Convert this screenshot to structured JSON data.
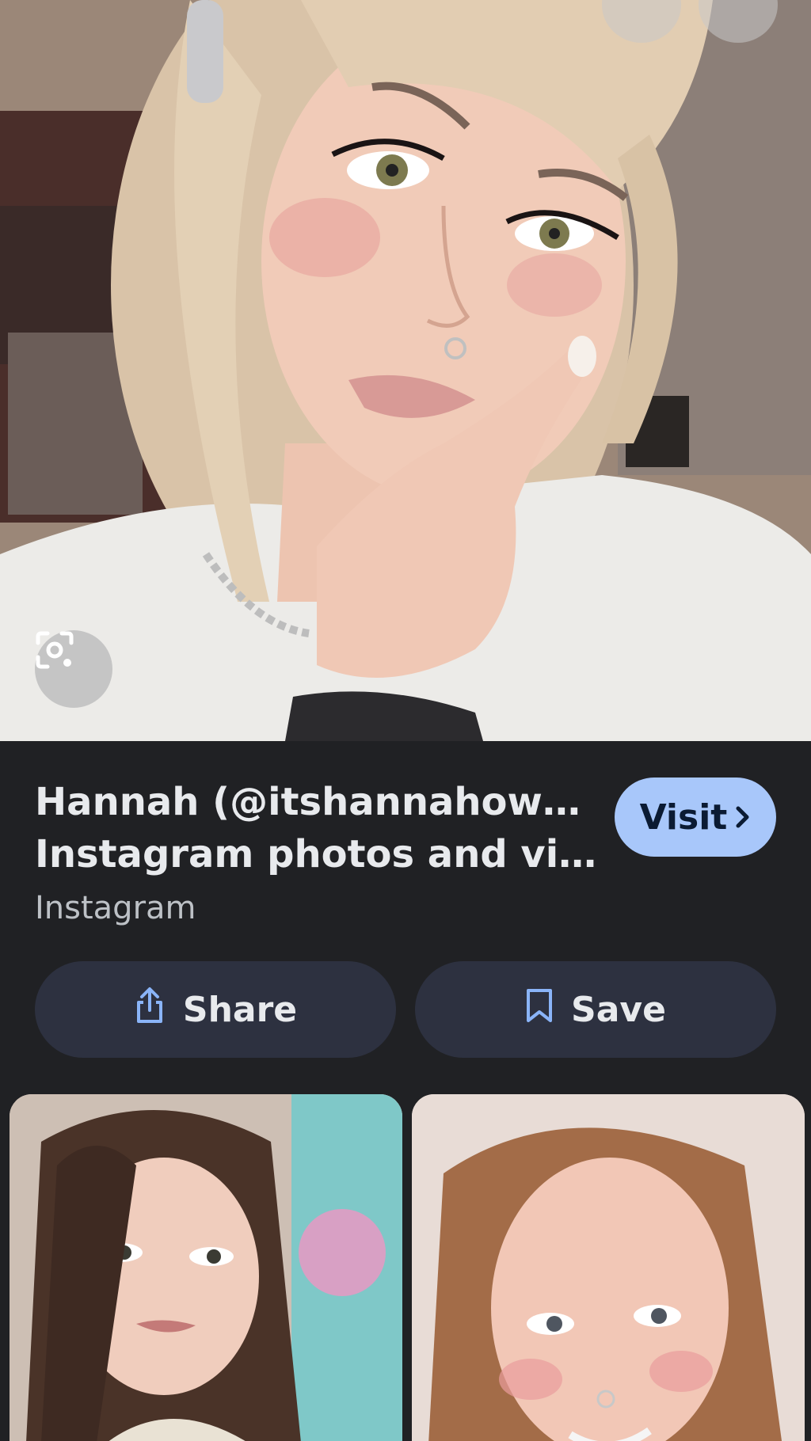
{
  "result": {
    "title_line1": "Hannah (@itshannahowo) •",
    "title_line2": "Instagram photos and vide…",
    "source": "Instagram",
    "visit_label": "Visit"
  },
  "actions": {
    "share_label": "Share",
    "save_label": "Save"
  },
  "icons": {
    "more": "more-horiz-icon",
    "close": "close-icon",
    "lens": "google-lens-icon",
    "share": "share-icon",
    "save": "bookmark-icon",
    "visit": "chevron-right-icon"
  },
  "colors": {
    "background": "#202124",
    "visit_button": "#a8c7fa",
    "action_button": "#2d3140",
    "icon_blue": "#8ab4f8"
  }
}
